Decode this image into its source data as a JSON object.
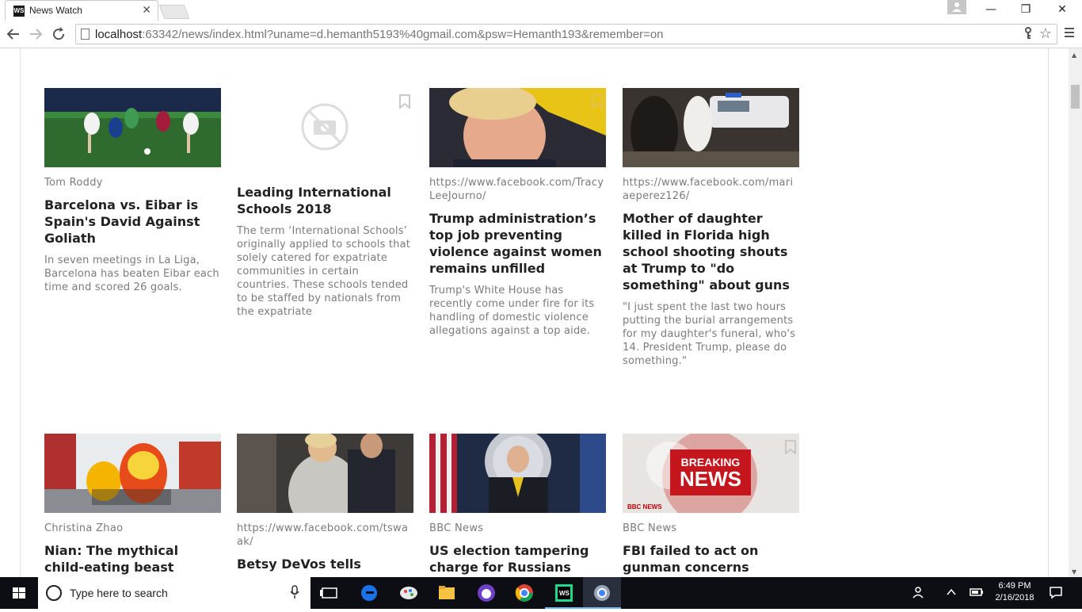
{
  "window": {
    "tab_title": "News Watch",
    "tab_favicon_text": "WS",
    "tab_close": "✕",
    "minimize": "—",
    "restore": "❐",
    "close": "✕"
  },
  "toolbar": {
    "url_host": "localhost",
    "url_rest": ":63342/news/index.html?uname=d.hemanth5193%40gmail.com&psw=Hemanth193&remember=on",
    "back_icon": "back-arrow-icon",
    "forward_icon": "forward-arrow-icon",
    "reload_icon": "reload-icon"
  },
  "articles": [
    {
      "source": "Tom Roddy",
      "headline": "Barcelona vs. Eibar is Spain's David Against Goliath",
      "description": "In seven meetings in La Liga, Barcelona has beaten Eibar each time and scored 26 goals.",
      "image": "soccer-match-photo"
    },
    {
      "source": "",
      "headline": "Leading International Schools 2018",
      "description": "The term ‘International Schools’ originally applied to schools that solely catered for expatriate communities in certain countries. These schools tended to be staffed by nationals from the expatriate",
      "image": "no-image-placeholder"
    },
    {
      "source": "https://www.facebook.com/TracyLeeJourno/",
      "headline": "Trump administration’s top job preventing violence against women remains unfilled",
      "description": "Trump's White House has recently come under fire for its handling of domestic violence allegations against a top aide.",
      "image": "trump-photo"
    },
    {
      "source": "https://www.facebook.com/mariaeperez126/",
      "headline": "Mother of daughter killed in Florida high school shooting shouts at Trump to \"do something\" about guns",
      "description": "\"I just spent the last two hours putting the burial arrangements for my daughter's funeral, who's 14. President Trump, please do something.\"",
      "image": "police-scene-photo"
    },
    {
      "source": "Christina Zhao",
      "headline": "Nian: The mythical child-eating beast behind the",
      "description": "",
      "image": "lion-dance-photo"
    },
    {
      "source": "https://www.facebook.com/tswaak/",
      "headline": "Betsy DeVos tells",
      "description": "",
      "image": "devos-photo"
    },
    {
      "source": "BBC News",
      "headline": "US election tampering charge for Russians",
      "description": "",
      "image": "doj-press-photo"
    },
    {
      "source": "BBC News",
      "headline": "FBI failed to act on gunman concerns",
      "description": "",
      "image": "breaking-news-graphic"
    }
  ],
  "breaking_graphic": {
    "line1": "BREAKING",
    "line2": "NEWS",
    "brand": "BBC NEWS"
  },
  "taskbar": {
    "search_placeholder": "Type here to search",
    "time": "6:49 PM",
    "date": "2/16/2018"
  }
}
